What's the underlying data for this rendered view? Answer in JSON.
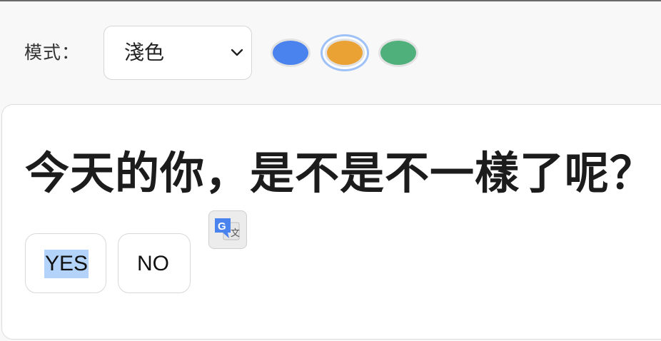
{
  "toolbar": {
    "mode_label": "模式：",
    "mode_select": {
      "selected": "淺色",
      "icon": "chevron-down-icon"
    },
    "color_swatches": [
      {
        "name": "blue",
        "color": "#4a82ee",
        "selected": false
      },
      {
        "name": "orange",
        "color": "#eaa235",
        "selected": true
      },
      {
        "name": "green",
        "color": "#4fb07c",
        "selected": false
      }
    ]
  },
  "card": {
    "question": "今天的你，是不是不一樣了呢？",
    "yes_label": "YES",
    "no_label": "NO",
    "translate_icon": "google-translate-icon"
  },
  "colors": {
    "accent_ring": "#9ec1f7",
    "text_selection": "#b4d3fb"
  }
}
